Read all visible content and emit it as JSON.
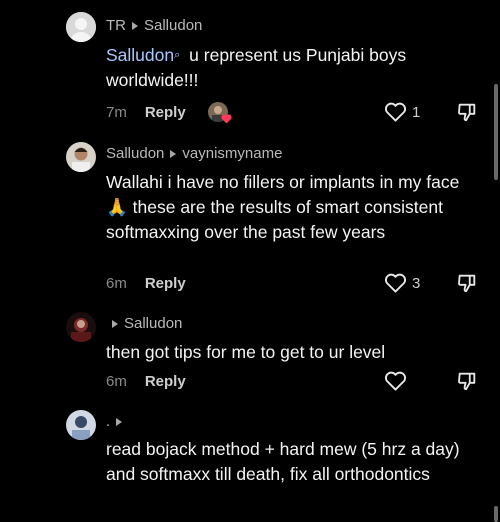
{
  "comments": [
    {
      "author": "TR",
      "reply_to": "Salludon",
      "mention": "Salludon",
      "text": " u represent us Punjabi boys worldwide!!!",
      "time": "7m",
      "reply_label": "Reply",
      "likes": "1"
    },
    {
      "author": "Salludon",
      "reply_to": "vaynismyname",
      "text": "Wallahi i have no fillers or implants in my face 🙏 these are the results of smart consistent softmaxxing over the past few years",
      "time": "6m",
      "reply_label": "Reply",
      "likes": "3"
    },
    {
      "author": "",
      "reply_to": "Salludon",
      "text": "then got tips for me to get to ur level",
      "time": "6m",
      "reply_label": "Reply",
      "likes": ""
    },
    {
      "author": ".",
      "reply_to": "",
      "text": "read bojack method + hard mew (5 hrz a day) and softmaxx till death, fix all orthodontics",
      "time": "",
      "reply_label": "",
      "likes": ""
    }
  ],
  "colors": {
    "background": "#000000",
    "mention": "#a9c8ff",
    "liked_heart_badge": "#ff3b5c"
  },
  "icons": {
    "like": "heart-outline-icon",
    "dislike": "thumbs-down-outline-icon",
    "reply_arrow": "triangle-right-icon",
    "mention": "search-glass-icon"
  }
}
